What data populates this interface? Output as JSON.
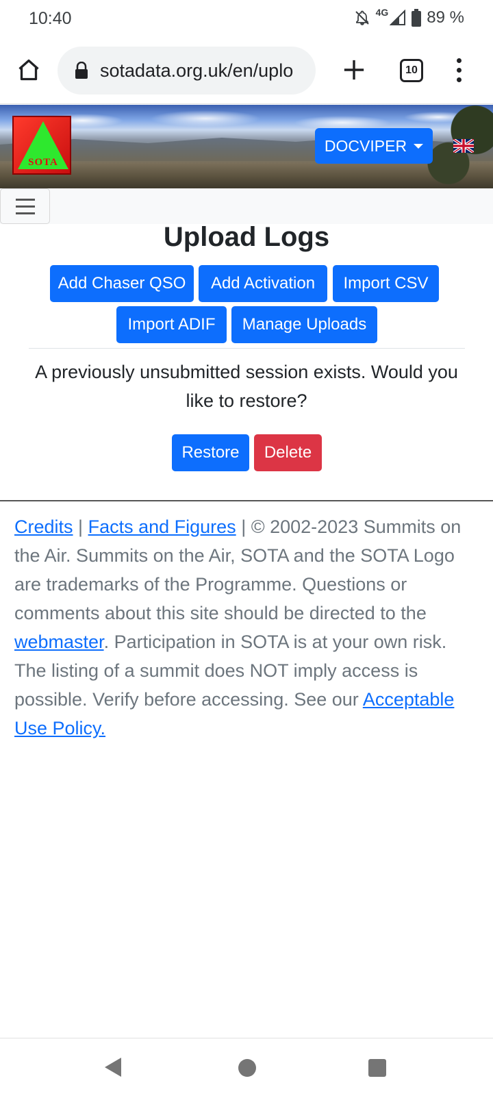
{
  "status_bar": {
    "time": "10:40",
    "network": "4G",
    "battery": "89 %",
    "icons": [
      "notifications-off-icon",
      "signal-icon",
      "battery-icon"
    ]
  },
  "browser": {
    "url": "sotadata.org.uk/en/uplo",
    "tab_count": "10",
    "icons": [
      "home-icon",
      "lock-icon",
      "plus-icon",
      "tabs-icon",
      "more-vert-icon"
    ]
  },
  "banner": {
    "logo_text": "SOTA",
    "user_menu": "DOCVIPER",
    "flag": "uk-flag-icon"
  },
  "main": {
    "title": "Upload Logs",
    "buttons": {
      "add_chaser": "Add Chaser QSO",
      "add_activation": "Add Activation",
      "import_csv": "Import CSV",
      "import_adif": "Import ADIF",
      "manage_uploads": "Manage Uploads"
    },
    "session_message": "A previously unsubmitted session exists. Would you like to restore?",
    "restore_label": "Restore",
    "delete_label": "Delete"
  },
  "footer": {
    "credits": "Credits",
    "sep": "|",
    "facts": "Facts and Figures",
    "text1": "| © 2002-2023 Summits on the Air. Summits on the Air, SOTA and the SOTA Logo are trademarks of the Programme. Questions or comments about this site should be directed to the",
    "webmaster": "webmaster",
    "text2": ". Participation in SOTA is at your own risk. The listing of a summit does NOT imply access is possible. Verify before accessing. See our",
    "policy": "Acceptable Use Policy."
  },
  "colors": {
    "primary": "#0d6efd",
    "danger": "#dc3545",
    "muted": "#6c757d"
  }
}
